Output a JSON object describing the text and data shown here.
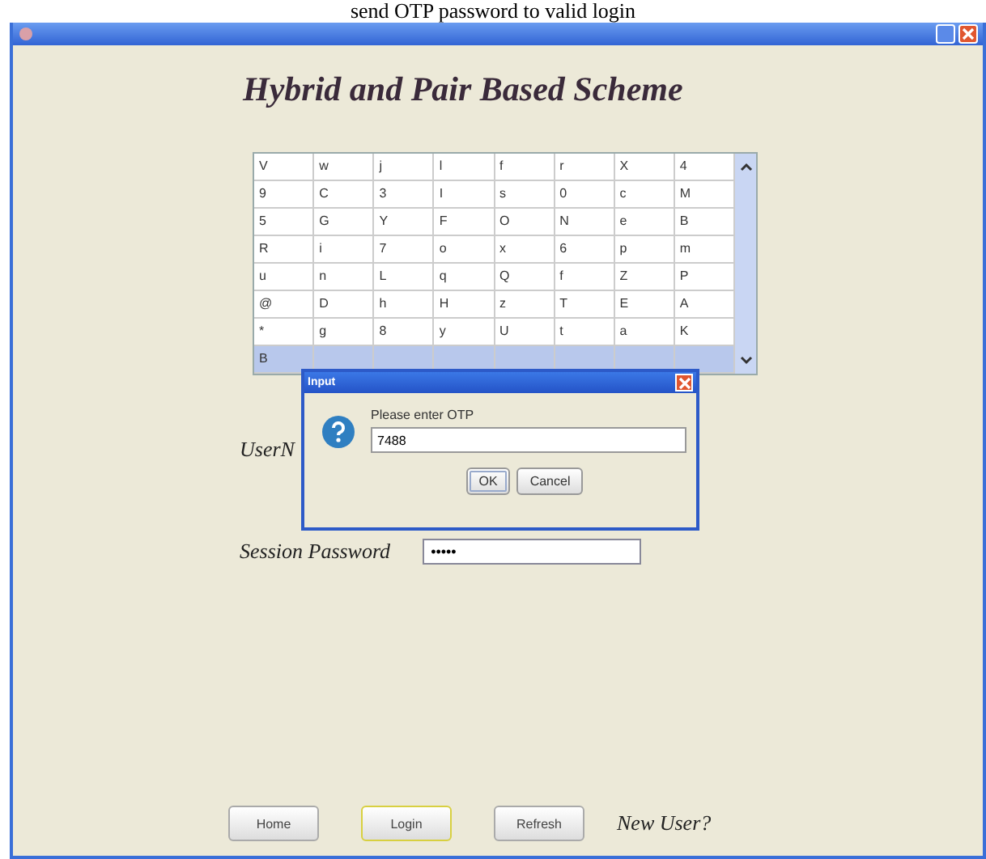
{
  "caption": "send OTP password to valid login",
  "window": {
    "heading": "Hybrid and Pair Based Scheme"
  },
  "grid": {
    "rows": [
      {
        "selected": false,
        "cells": [
          "V",
          "w",
          "j",
          "l",
          "f",
          "r",
          "X",
          "4"
        ]
      },
      {
        "selected": false,
        "cells": [
          "9",
          "C",
          "3",
          "I",
          "s",
          "0",
          "c",
          "M"
        ]
      },
      {
        "selected": false,
        "cells": [
          "5",
          "G",
          "Y",
          "F",
          "O",
          "N",
          "e",
          "B"
        ]
      },
      {
        "selected": false,
        "cells": [
          "R",
          "i",
          "7",
          "o",
          "x",
          "6",
          "p",
          "m"
        ]
      },
      {
        "selected": false,
        "cells": [
          "u",
          "n",
          "L",
          "q",
          "Q",
          "f",
          "Z",
          "P"
        ]
      },
      {
        "selected": false,
        "cells": [
          "@",
          "D",
          "h",
          "H",
          "z",
          "T",
          "E",
          "A"
        ]
      },
      {
        "selected": false,
        "cells": [
          "*",
          "g",
          "8",
          "y",
          "U",
          "t",
          "a",
          "K"
        ]
      },
      {
        "selected": true,
        "cells": [
          "B"
        ]
      }
    ]
  },
  "form": {
    "username_label": "UserN",
    "password_label": "Session Password",
    "password_value": "•••••"
  },
  "dialog": {
    "title": "Input",
    "message": "Please enter OTP",
    "value": "7488",
    "buttons": [
      {
        "label": "OK",
        "focused": true
      },
      {
        "label": "Cancel",
        "focused": false
      }
    ]
  },
  "buttons": [
    {
      "label": "Home",
      "focused": false
    },
    {
      "label": "Login",
      "focused": true
    },
    {
      "label": "Refresh",
      "focused": false
    }
  ],
  "new_user": "New User?"
}
